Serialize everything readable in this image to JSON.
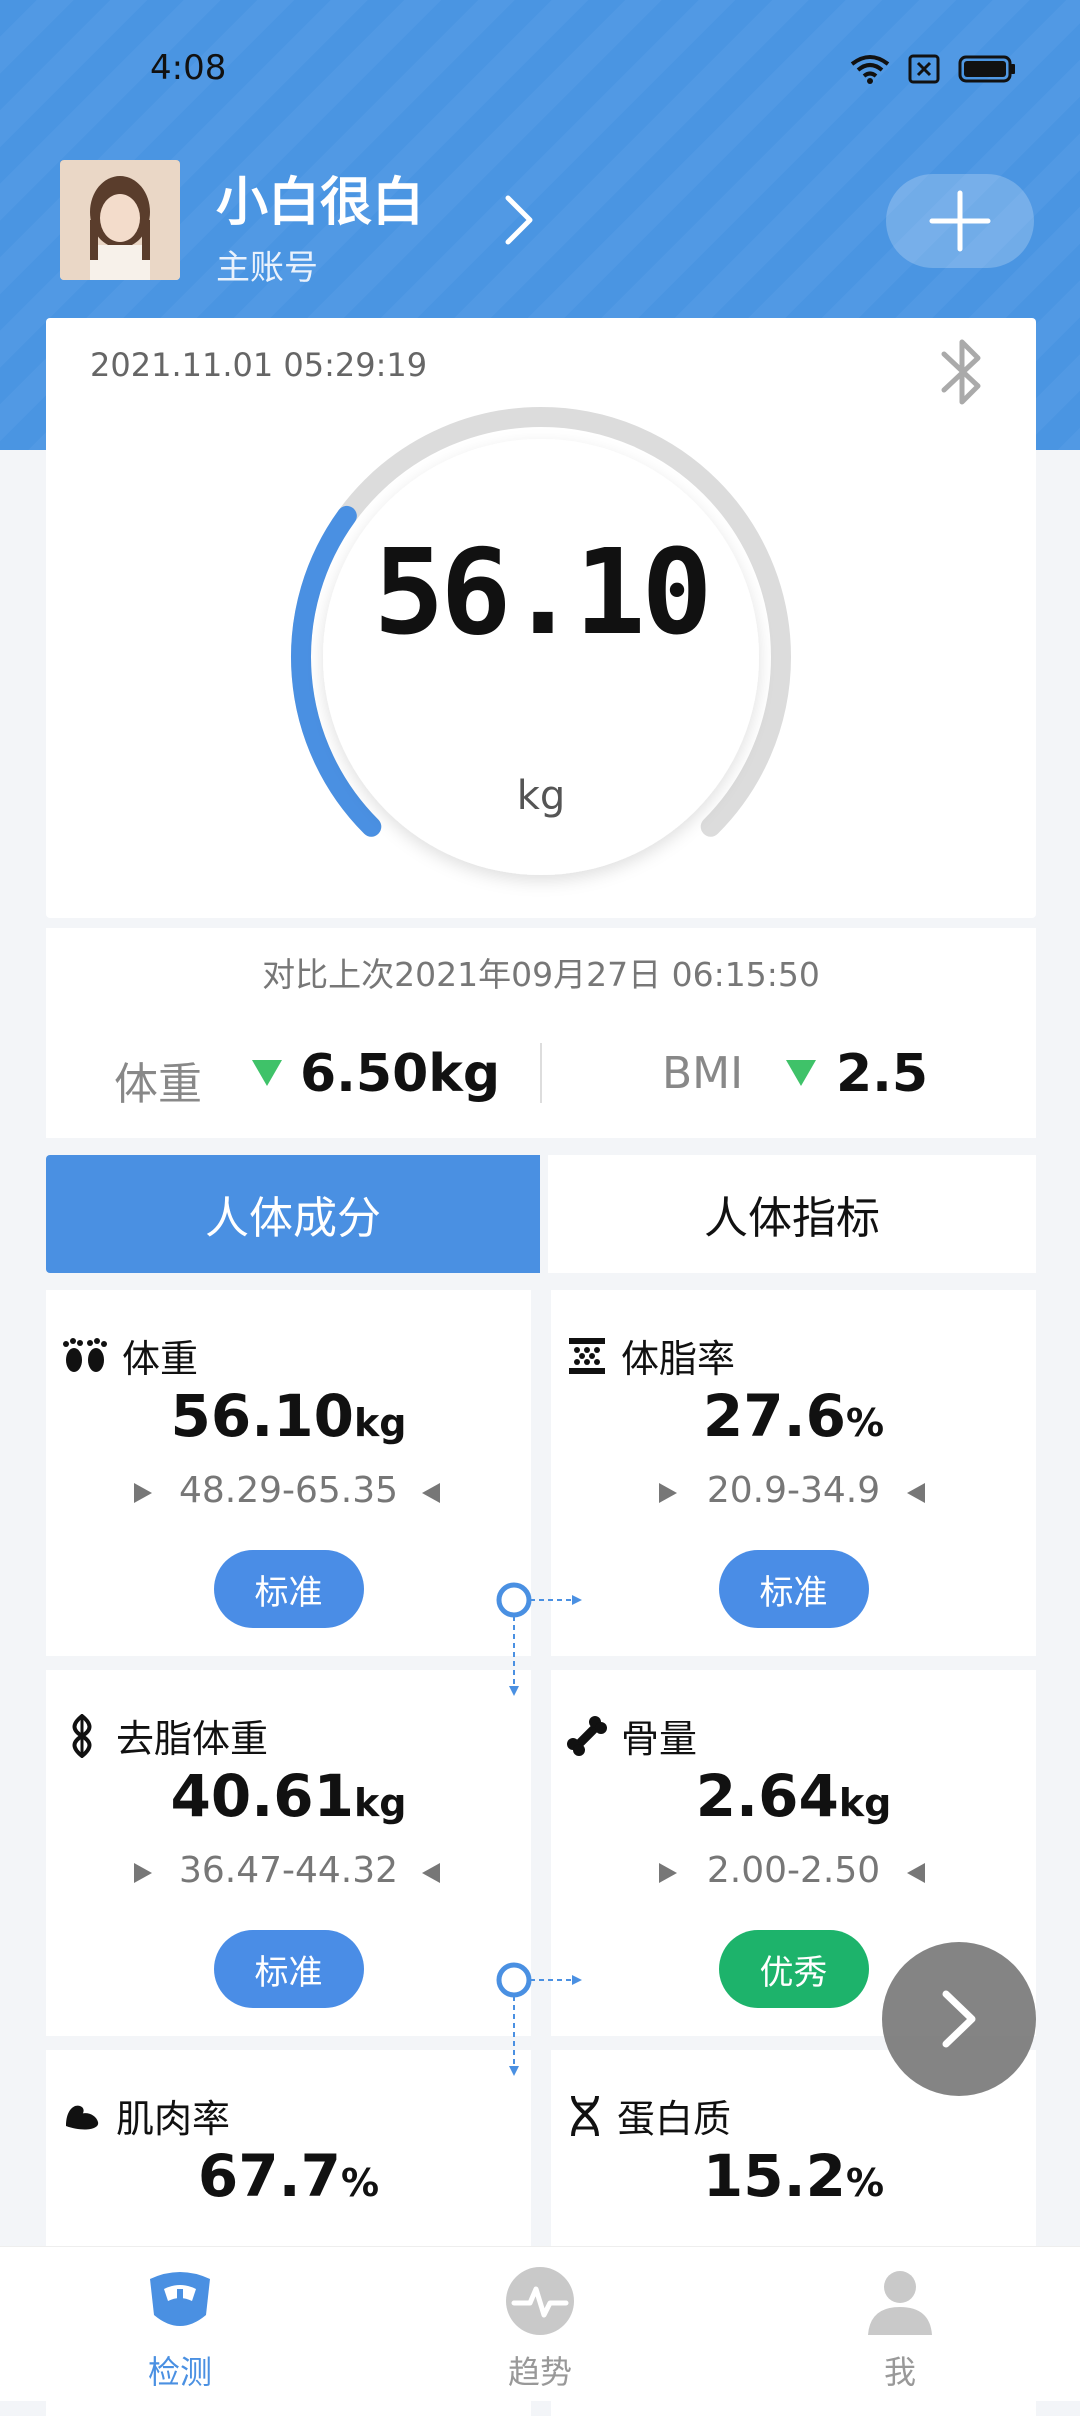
{
  "status_bar": {
    "time": "4:08"
  },
  "profile": {
    "name": "小白很白",
    "account_type": "主账号"
  },
  "measurement": {
    "datetime": "2021.11.01 05:29:19",
    "weight": "56.10",
    "unit": "kg",
    "gauge_fraction": 0.3
  },
  "comparison": {
    "title": "对比上次2021年09月27日 06:15:50",
    "weight_label": "体重",
    "weight_change": "6.50kg",
    "bmi_label": "BMI",
    "bmi_change": "2.5",
    "trend": "down"
  },
  "tabs": {
    "composition": "人体成分",
    "indicators": "人体指标"
  },
  "metrics": [
    {
      "name": "体重",
      "value": "56.10",
      "unit": "kg",
      "range": "48.29-65.35",
      "status": "标准",
      "status_color": "#4a8de6",
      "icon": "footprints-icon"
    },
    {
      "name": "体脂率",
      "value": "27.6",
      "unit": "%",
      "range": "20.9-34.9",
      "status": "标准",
      "status_color": "#4a8de6",
      "icon": "fat-cells-icon"
    },
    {
      "name": "去脂体重",
      "value": "40.61",
      "unit": "kg",
      "range": "36.47-44.32",
      "status": "标准",
      "status_color": "#4a8de6",
      "icon": "lean-mass-icon"
    },
    {
      "name": "骨量",
      "value": "2.64",
      "unit": "kg",
      "range": "2.00-2.50",
      "status": "优秀",
      "status_color": "#1db36b",
      "icon": "bone-icon"
    },
    {
      "name": "肌肉率",
      "value": "67.7",
      "unit": "%",
      "icon": "muscle-icon"
    },
    {
      "name": "蛋白质",
      "value": "15.2",
      "unit": "%",
      "icon": "dna-icon"
    }
  ],
  "nav": {
    "detect": "检测",
    "trend": "趋势",
    "me": "我"
  },
  "colors": {
    "primary": "#4a90e2",
    "success": "#1db36b",
    "down_arrow": "#3fc269"
  }
}
